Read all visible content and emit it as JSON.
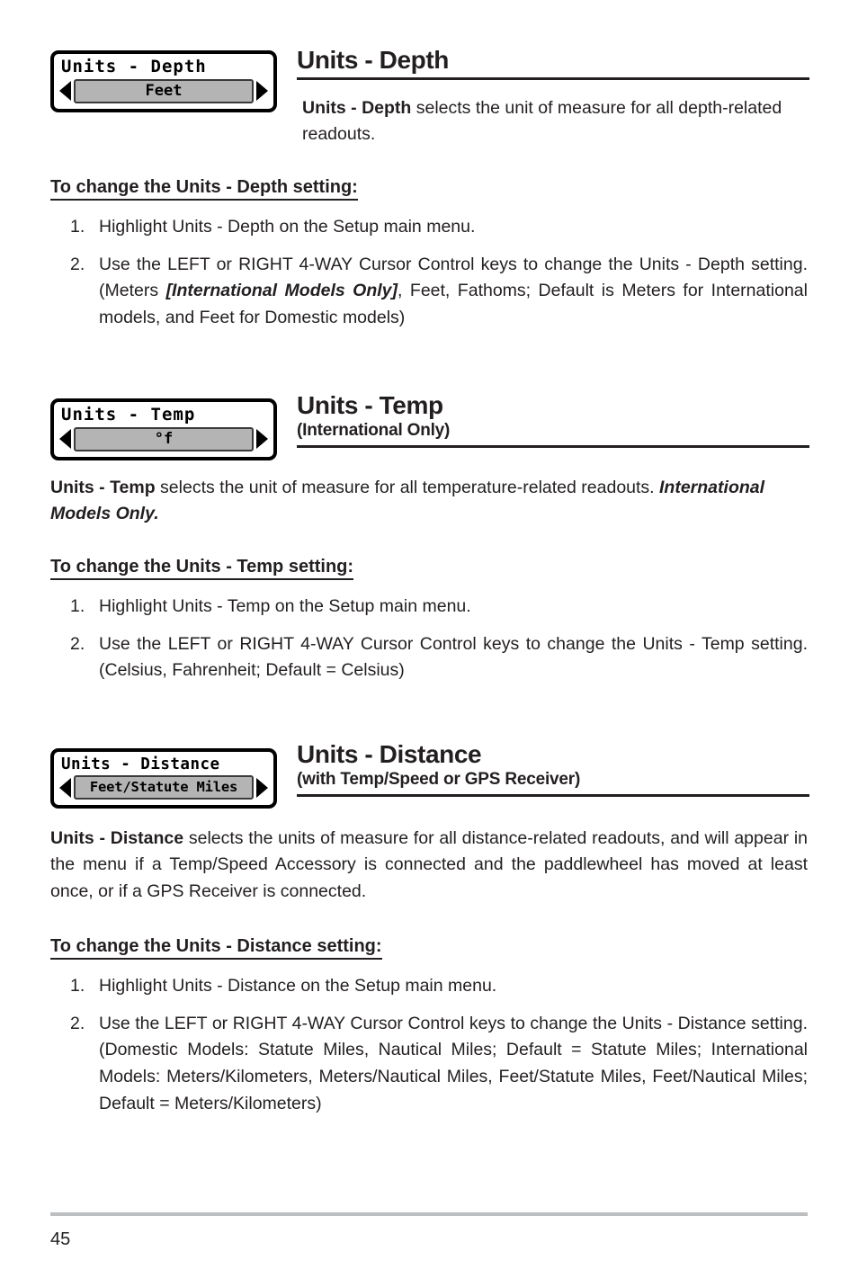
{
  "page": {
    "number": "45"
  },
  "sections": [
    {
      "widget": {
        "title": "Units - Depth",
        "value": "Feet",
        "left_arrow": "left-arrow-icon",
        "right_arrow": "right-arrow-icon"
      },
      "heading": "Units - Depth",
      "subheading": "",
      "intro_html": "<b>Units - Depth</b> selects the unit of measure for all depth-related readouts.",
      "instruction_heading": "To change the Units - Depth setting:",
      "steps": [
        {
          "number": "1.",
          "html": "Highlight Units - Depth on the Setup main menu."
        },
        {
          "number": "2.",
          "html": "Use the LEFT or RIGHT 4-WAY Cursor Control keys to change the Units - Depth setting. (Meters <b><i>[International Models Only]</i></b>, Feet, Fathoms; Default is Meters for International models, and Feet for Domestic models)"
        }
      ]
    },
    {
      "widget": {
        "title": "Units - Temp",
        "value": "°f",
        "left_arrow": "left-arrow-icon",
        "right_arrow": "right-arrow-icon"
      },
      "heading": "Units - Temp",
      "subheading": "(International Only)",
      "intro_html": "<b>Units - Temp</b> selects the unit of measure for all temperature-related readouts. <b><i>International Models Only.</i></b>",
      "instruction_heading": "To change the Units - Temp setting:",
      "steps": [
        {
          "number": "1.",
          "html": "Highlight Units - Temp on the Setup main menu."
        },
        {
          "number": "2.",
          "html": "Use the LEFT or RIGHT 4-WAY Cursor Control keys to change the Units - Temp setting. (Celsius, Fahrenheit; Default = Celsius)"
        }
      ]
    },
    {
      "widget": {
        "title": "Units - Distance",
        "value": "Feet/Statute Miles",
        "left_arrow": "left-arrow-icon",
        "right_arrow": "right-arrow-icon"
      },
      "heading": "Units - Distance",
      "subheading": "(with Temp/Speed or GPS Receiver)",
      "intro_html": "<b>Units - Distance</b> selects the units of measure for all distance-related readouts, and will appear in the menu if a Temp/Speed Accessory is connected and the paddlewheel has moved at least once, or if a GPS Receiver is connected.",
      "instruction_heading": "To change the Units - Distance setting:",
      "steps": [
        {
          "number": "1.",
          "html": "Highlight Units - Distance on the Setup main menu."
        },
        {
          "number": "2.",
          "html": "Use the LEFT or RIGHT 4-WAY Cursor Control keys to change the Units - Distance setting. (Domestic Models: Statute Miles, Nautical Miles; Default = Statute Miles; International Models: Meters/Kilometers, Meters/Nautical Miles, Feet/Statute Miles, Feet/Nautical Miles; Default = Meters/Kilometers)"
        }
      ]
    }
  ]
}
